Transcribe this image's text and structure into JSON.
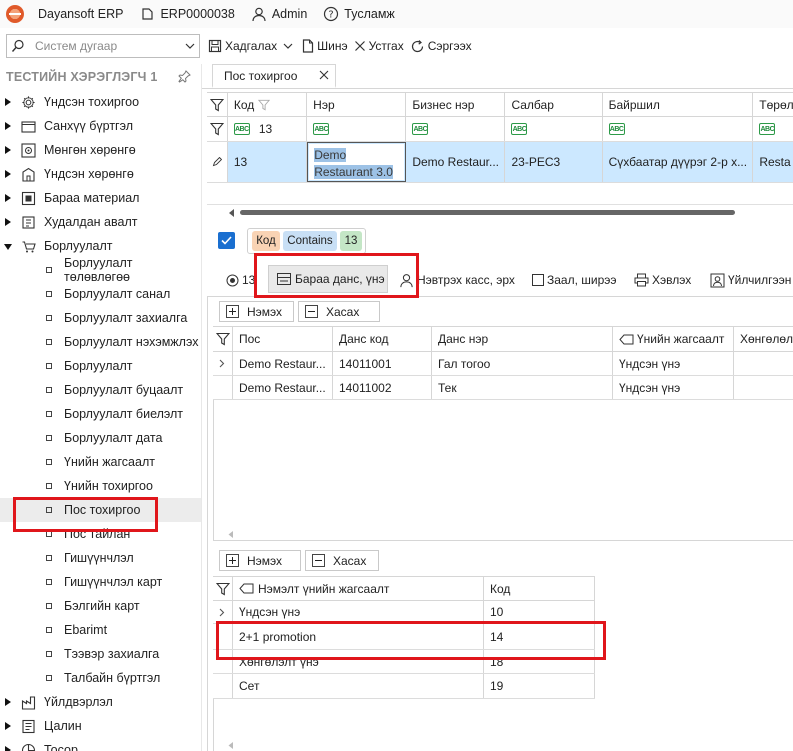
{
  "titlebar": {
    "app": "Dayansoft ERP",
    "db": "ERP0000038",
    "user": "Admin",
    "help": "Тусламж"
  },
  "search": {
    "placeholder": "Систем дугаар"
  },
  "toolbar": {
    "save": "Хадгалах",
    "new": "Шинэ",
    "delete": "Устгах",
    "refresh": "Сэргээх"
  },
  "sidebar": {
    "header": "ТЕСТИЙН ХЭРЭГЛЭГЧ 1",
    "top_items_a": [
      {
        "label": "Үндсэн тохиргоо",
        "icon": "gear-icon"
      },
      {
        "label": "Санхүү бүртгэл",
        "icon": "wallet-icon"
      },
      {
        "label": "Мөнгөн хөрөнгө",
        "icon": "safe-icon"
      },
      {
        "label": "Үндсэн хөрөнгө",
        "icon": "building-icon"
      },
      {
        "label": "Бараа материал",
        "icon": "box-icon"
      },
      {
        "label": "Худалдан авалт",
        "icon": "cart-icon"
      },
      {
        "label": "Борлуулалт",
        "icon": "sales-icon"
      }
    ],
    "sub_items": [
      "Борлуулалт төлөвлөгөө",
      "Борлуулалт санал",
      "Борлуулалт захиалга",
      "Борлуулалт нэхэмжлэх",
      "Борлуулалт",
      "Борлуулалт буцаалт",
      "Борлуулалт биелэлт",
      "Борлуулалт дата",
      "Үнийн жагсаалт",
      "Үнийн тохиргоо",
      "Пос тохиргоо",
      "Пос тайлан",
      "Гишүүнчлэл",
      "Гишүүнчлэл карт",
      "Бэлгийн карт",
      "Ebarimt",
      "Тээвэр захиалга",
      "Талбайн бүртгэл"
    ],
    "top_items_b": [
      {
        "label": "Үйлдвэрлэл",
        "icon": "factory-icon"
      },
      {
        "label": "Цалин",
        "icon": "money-icon"
      },
      {
        "label": "Тосор",
        "icon": "pie-icon"
      }
    ]
  },
  "tab": {
    "label": "Пос тохиргоо"
  },
  "main_grid": {
    "columns": [
      "Код",
      "Нэр",
      "Бизнес нэр",
      "Салбар",
      "Байршил",
      "Төрөл"
    ],
    "filter": {
      "code": "13"
    },
    "row": {
      "code": "13",
      "name_line1": "Demo",
      "name_line2": "Restaurant 3.0",
      "business": "Demo Restaur...",
      "branch": "23-PEC3",
      "location": "Сүхбаатар дүүрэг 2-р х...",
      "type": "Resta"
    }
  },
  "filter_chips": {
    "field": "Код",
    "op": "Contains",
    "value": "13"
  },
  "subtabs": [
    {
      "label": "13",
      "icon": "radio-icon"
    },
    {
      "label": "Бараа данс, үнэ",
      "icon": "register-icon"
    },
    {
      "label": "Нэвтрэх касс, эрх",
      "icon": "person-icon"
    },
    {
      "label": "Заал, ширээ",
      "icon": "square-icon"
    },
    {
      "label": "Хэвлэх",
      "icon": "printer-icon"
    },
    {
      "label": "Үйлчилгээн",
      "icon": "service-icon"
    }
  ],
  "buttons": {
    "add": "Нэмэх",
    "remove": "Хасах"
  },
  "accounts_grid": {
    "columns": [
      "Пос",
      "Данс код",
      "Данс нэр",
      "Үнийн жагсаалт",
      "Хөнгөлөлт"
    ],
    "rows": [
      {
        "pos": "Demo Restaur...",
        "code": "14011001",
        "name": "Гал тогоо",
        "price": "Үндсэн үнэ"
      },
      {
        "pos": "Demo Restaur...",
        "code": "14011002",
        "name": "Тек",
        "price": "Үндсэн үнэ"
      }
    ]
  },
  "price_grid": {
    "columns": [
      "Нэмэлт үнийн жагсаалт",
      "Код"
    ],
    "rows": [
      {
        "name": "Үндсэн үнэ",
        "code": "10"
      },
      {
        "name": "2+1 promotion",
        "code": "14"
      },
      {
        "name": "Хөнгөлэлт үнэ",
        "code": "18"
      },
      {
        "name": "Сет",
        "code": "19"
      }
    ]
  },
  "colors": {
    "selection": "#cce8ff",
    "chip_field": "#f9d3b4",
    "chip_op": "#c8dff5",
    "chip_value": "#c4e6c6",
    "highlight": "#e0161b",
    "check": "#1a6fd0"
  }
}
